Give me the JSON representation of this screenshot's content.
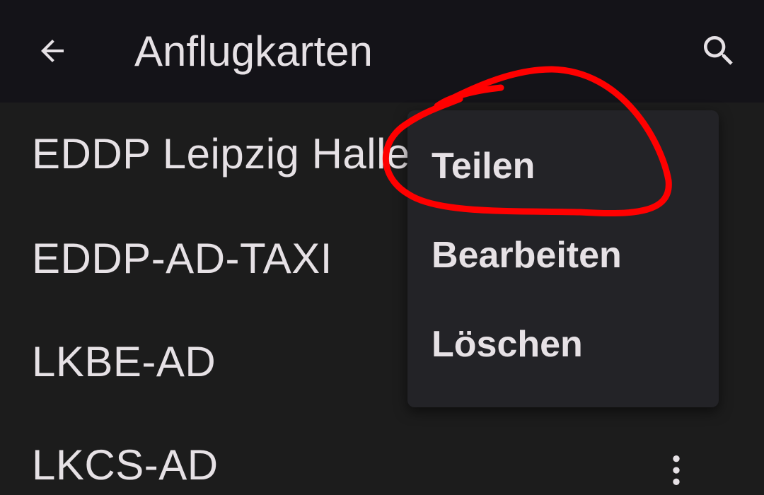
{
  "app_bar": {
    "title": "Anflugkarten",
    "back_icon": "arrow-back-icon",
    "search_icon": "search-icon"
  },
  "list": {
    "items": [
      {
        "label": "EDDP Leipzig Halle"
      },
      {
        "label": "EDDP-AD-TAXI"
      },
      {
        "label": "LKBE-AD"
      },
      {
        "label": "LKCS-AD"
      }
    ],
    "overflow_icon": "more-vert-icon"
  },
  "context_menu": {
    "items": [
      {
        "label": "Teilen"
      },
      {
        "label": "Bearbeiten"
      },
      {
        "label": "Löschen"
      }
    ]
  },
  "colors": {
    "app_bar_bg": "#141318",
    "list_bg": "#1c1c1c",
    "menu_bg": "#232327",
    "text": "#e6e1e5",
    "annotation": "#ff0000"
  }
}
